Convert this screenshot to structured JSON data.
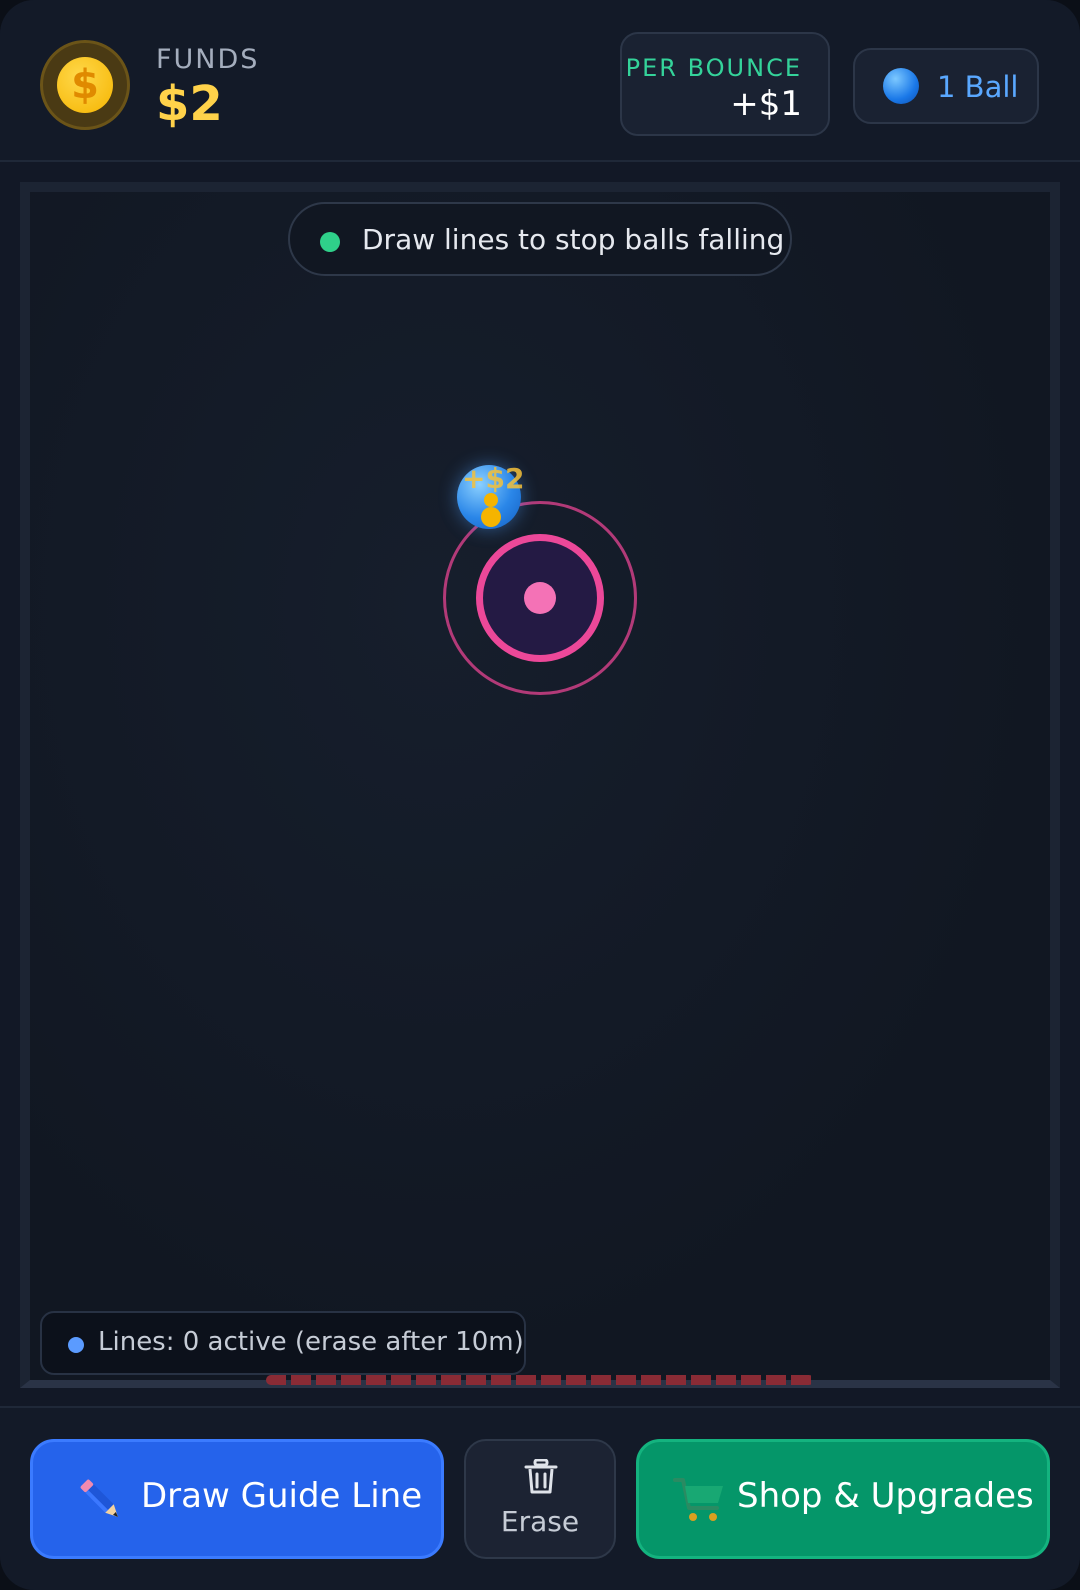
{
  "header": {
    "coin_icon": "dollar-coin-icon",
    "coin_glyph": "$",
    "funds_label": "FUNDS",
    "funds_value": "$2",
    "per_bounce_label": "PER BOUNCE",
    "per_bounce_value": "+$1",
    "ball_count_label": "1 Ball",
    "ball_icon": "blue-ball-icon"
  },
  "playfield": {
    "hint_text": "Draw lines to stop balls falling",
    "hint_color": "#2fd08a",
    "float_reward": "+$2",
    "target_color": "#ec4899",
    "ball_color": "#2a86e8",
    "lines_status": "Lines: 0 active (erase after 10m)",
    "danger_color": "#8a2b35"
  },
  "actions": {
    "draw_label": "Draw Guide Line",
    "draw_icon": "pencil-icon",
    "draw_color": "#2563eb",
    "erase_label": "Erase",
    "erase_icon": "trash-icon",
    "shop_label": "Shop & Upgrades",
    "shop_icon": "cart-icon",
    "shop_color": "#059669"
  }
}
